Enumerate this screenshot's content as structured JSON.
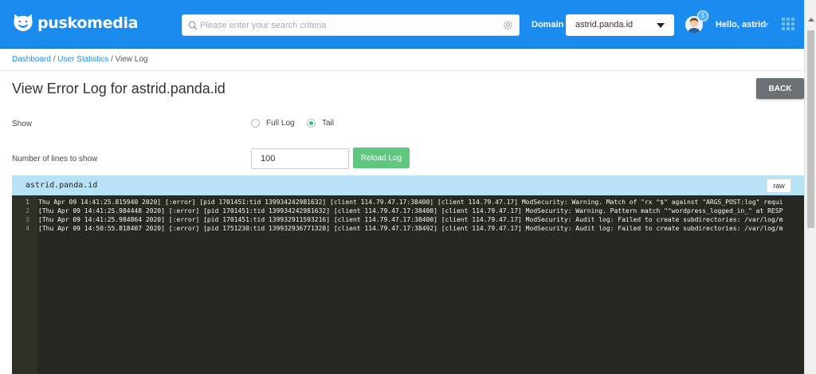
{
  "header": {
    "brand": "puskomedia",
    "search_placeholder": "Please enter your search criteria",
    "domain_label": "Domain",
    "domain_value": "astrid.panda.id",
    "notification_count": "1",
    "greeting": "Hello, astrid",
    "colors": {
      "bar": "#1a8cf0"
    }
  },
  "breadcrumb": {
    "items": [
      "Dashboard",
      "User Statistics"
    ],
    "separator": " / ",
    "current": "View Log"
  },
  "page": {
    "title": "View Error Log for astrid.panda.id",
    "back_label": "BACK"
  },
  "form": {
    "show_label": "Show",
    "options": [
      "Full Log",
      "Tail"
    ],
    "selected": "Tail",
    "lines_label": "Number of lines to show",
    "lines_value": "100",
    "reload_label": "Reload Log"
  },
  "log": {
    "title": "astrid.panda.id",
    "raw_label": "raw",
    "lines": [
      {
        "num": "1",
        "text": "Thu Apr 09 14:41:25.815940 2020] [:error] [pid 1701451:tid 139934242981632] [client 114.79.47.17:38400] [client 114.79.47.17] ModSecurity: Warning. Match of \"rx ^$\" against \"ARGS_POST:log\" requi"
      },
      {
        "num": "2",
        "text": "[Thu Apr 09 14:41:25.984448 2020] [:error] [pid 1701451:tid 139934242981632] [client 114.79.47.17:38400] [client 114.79.47.17] ModSecurity: Warning. Pattern match \"^wordpress_logged_in_\" at RESP"
      },
      {
        "num": "3",
        "text": "[Thu Apr 09 14:41:25.984864 2020] [:error] [pid 1701451:tid 139932911593216] [client 114.79.47.17:38400] [client 114.79.47.17] ModSecurity: Audit log: Failed to create subdirectories: /var/log/m"
      },
      {
        "num": "4",
        "text": "[Thu Apr 09 14:50:55.818407 2020] [:error] [pid 1751230:tid 139932936771328] [client 114.79.47.17:38492] [client 114.79.47.17] ModSecurity: Audit log: Failed to create subdirectories: /var/log/m"
      }
    ]
  },
  "icons": {
    "logo": "cat-logo-icon",
    "search": "search-icon",
    "settings": "gear-icon",
    "apps": "grid-icon"
  }
}
